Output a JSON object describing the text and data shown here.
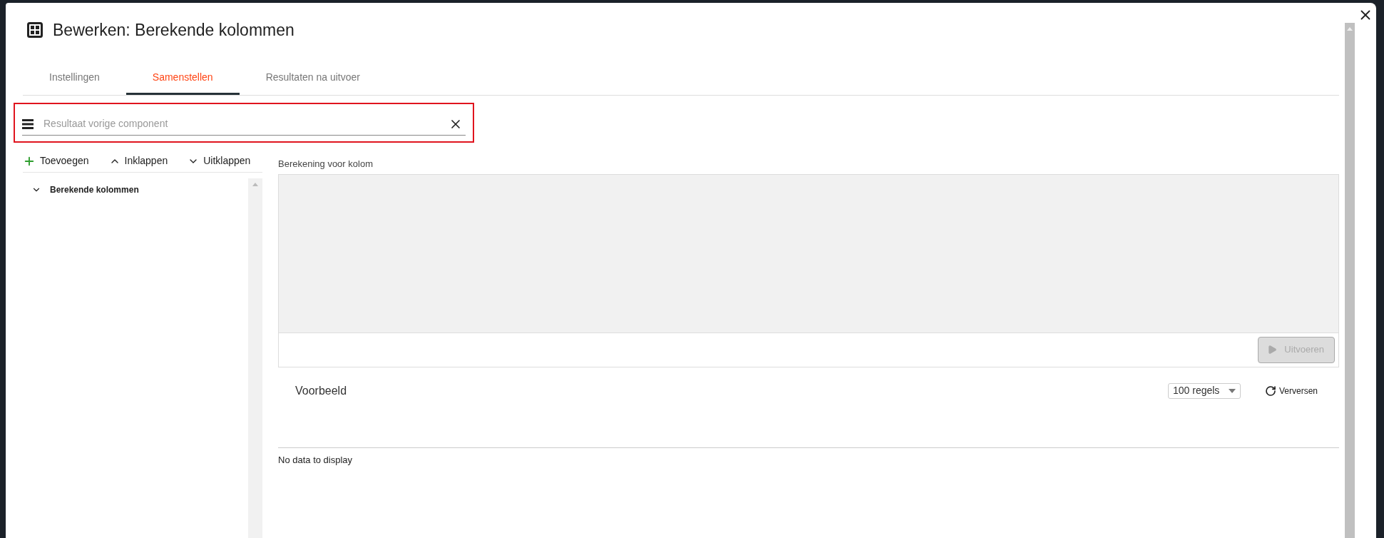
{
  "dialog": {
    "title": "Bewerken: Berekende kolommen"
  },
  "tabs": [
    {
      "label": "Instellingen",
      "selected": false
    },
    {
      "label": "Samenstellen",
      "selected": true
    },
    {
      "label": "Resultaten na uitvoer",
      "selected": false
    }
  ],
  "source_field": {
    "placeholder": "Resultaat vorige component",
    "highlighted": true
  },
  "tree_toolbar": [
    {
      "label": "Toevoegen",
      "kind": "add"
    },
    {
      "label": "Inklappen",
      "kind": "collapse"
    },
    {
      "label": "Uitklappen",
      "kind": "expand"
    }
  ],
  "tree": [
    {
      "label": "Berekende kolommen",
      "expanded": true
    }
  ],
  "editor": {
    "label": "Berekening voor kolom",
    "run_button": {
      "label": "Uitvoeren",
      "disabled": true
    }
  },
  "preview": {
    "title": "Voorbeeld",
    "rows_select": {
      "value": "100 regels"
    },
    "refresh_button": "Verversen",
    "empty_message": "No data to display"
  }
}
